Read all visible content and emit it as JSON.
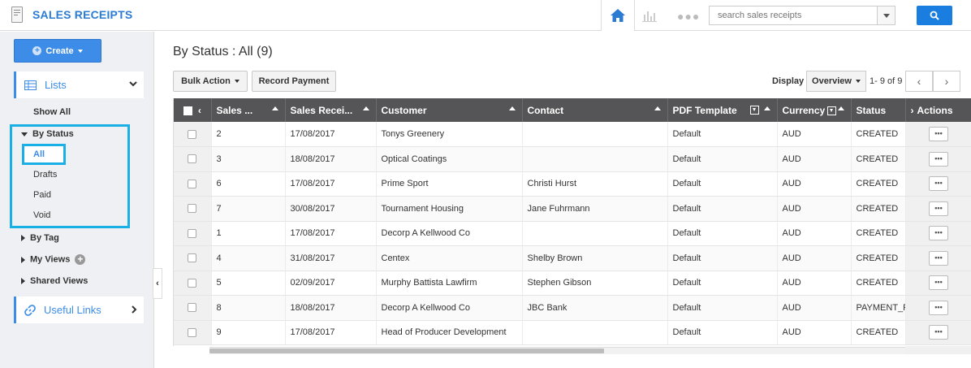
{
  "header": {
    "title": "SALES RECEIPTS",
    "search_placeholder": "search sales receipts",
    "home_icon": "home-icon",
    "colors": {
      "brand": "#2a7bd2",
      "search_button": "#1a7ee0"
    }
  },
  "sidebar": {
    "create_label": "Create",
    "lists_label": "Lists",
    "show_all": "Show All",
    "by_status": "By Status",
    "status_items": [
      "All",
      "Drafts",
      "Paid",
      "Void"
    ],
    "by_tag": "By Tag",
    "my_views": "My Views",
    "shared_views": "Shared Views",
    "useful_links": "Useful Links",
    "colors": {
      "highlight": "#1ab0e6",
      "accent": "#3c8ce8"
    }
  },
  "main": {
    "title": "By Status : All (9)",
    "bulk_action": "Bulk Action",
    "record_payment": "Record Payment",
    "display_label": "Display",
    "display_value": "Overview",
    "range": "1- 9 of 9",
    "columns": [
      "Sales ...",
      "Sales Recei...",
      "Customer",
      "Contact",
      "PDF Template",
      "Currency",
      "Status",
      "Actions"
    ],
    "rows": [
      [
        "2",
        "17/08/2017",
        "Tonys Greenery",
        "",
        "Default",
        "AUD",
        "CREATED"
      ],
      [
        "3",
        "18/08/2017",
        "Optical Coatings",
        "",
        "Default",
        "AUD",
        "CREATED"
      ],
      [
        "6",
        "17/08/2017",
        "Prime Sport",
        "Christi Hurst",
        "Default",
        "AUD",
        "CREATED"
      ],
      [
        "7",
        "30/08/2017",
        "Tournament Housing",
        "Jane Fuhrmann",
        "Default",
        "AUD",
        "CREATED"
      ],
      [
        "1",
        "17/08/2017",
        "Decorp A Kellwood Co",
        "",
        "Default",
        "AUD",
        "CREATED"
      ],
      [
        "4",
        "31/08/2017",
        "Centex",
        "Shelby Brown",
        "Default",
        "AUD",
        "CREATED"
      ],
      [
        "5",
        "02/09/2017",
        "Murphy Battista Lawfirm",
        "Stephen Gibson",
        "Default",
        "AUD",
        "CREATED"
      ],
      [
        "8",
        "18/08/2017",
        "Decorp A Kellwood Co",
        "JBC Bank",
        "Default",
        "AUD",
        "PAYMENT_R"
      ],
      [
        "9",
        "17/08/2017",
        "Head of Producer Development",
        "",
        "Default",
        "AUD",
        "CREATED"
      ]
    ],
    "row_action_label": "•••"
  }
}
